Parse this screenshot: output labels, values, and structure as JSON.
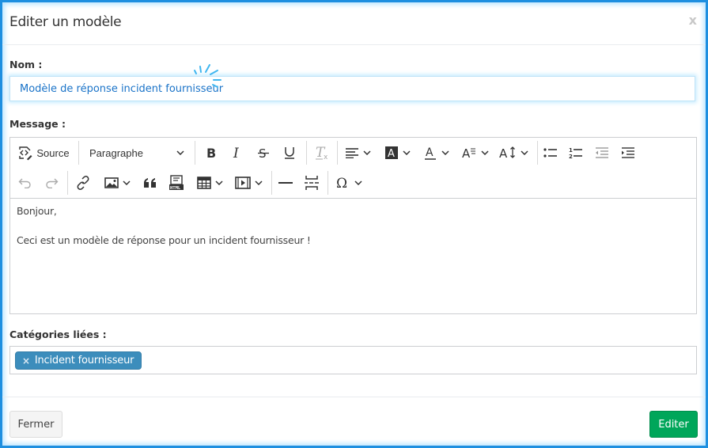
{
  "modal": {
    "title": "Editer un modèle",
    "close_label": "x"
  },
  "form": {
    "nom_label": "Nom :",
    "nom_value": "Modèle de réponse incident fournisseur",
    "message_label": "Message :",
    "categories_label": "Catégories liées :"
  },
  "toolbar": {
    "source_label": "Source",
    "heading_select": "Paragraphe",
    "row1_icons": [
      "source-icon",
      "paragraph-select",
      "bold-icon",
      "italic-icon",
      "strikethrough-icon",
      "underline-icon",
      "remove-format-icon",
      "align-icon",
      "font-background-color-icon",
      "font-color-icon",
      "font-family-icon",
      "font-size-icon",
      "bulleted-list-icon",
      "numbered-list-icon",
      "outdent-icon",
      "indent-icon"
    ],
    "row2_icons": [
      "undo-icon",
      "redo-icon",
      "link-icon",
      "image-icon",
      "blockquote-icon",
      "html-embed-icon",
      "table-icon",
      "media-embed-icon",
      "horizontal-line-icon",
      "page-break-icon",
      "special-characters-icon"
    ]
  },
  "editor_content": {
    "paragraphs": [
      "Bonjour,",
      "Ceci est un modèle de réponse pour un incident fournisseur !"
    ]
  },
  "categories": {
    "tags": [
      {
        "label": "Incident fournisseur",
        "remove": "×"
      }
    ]
  },
  "footer": {
    "close_button": "Fermer",
    "submit_button": "Editer"
  },
  "colors": {
    "tag": "#3c8dbc",
    "submit": "#00a65a",
    "input_text": "#1a73c8",
    "frame": "#1e8fe0"
  }
}
